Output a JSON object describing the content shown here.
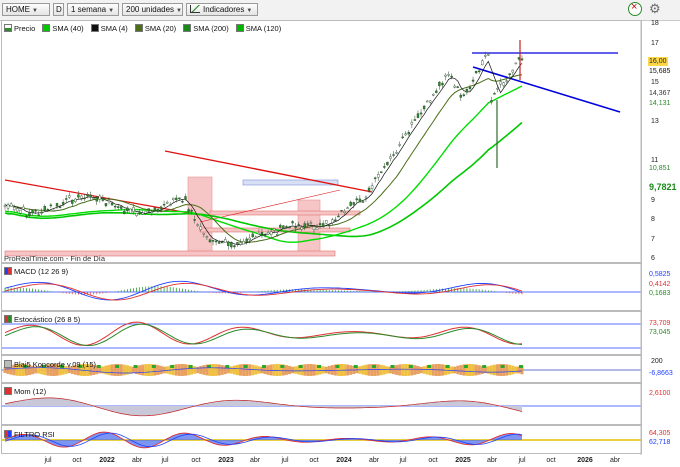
{
  "toolbar": {
    "symbol": "HOME",
    "type_btn": "D",
    "period": "1 semana",
    "units": "200 unidades",
    "indicators": "Indicadores"
  },
  "legend": {
    "price": "Precio",
    "sma40": "SMA (40)",
    "sma4": "SMA (4)",
    "sma20": "SMA (20)",
    "sma200": "SMA (200)",
    "sma120": "SMA (120)",
    "source": "ProRealTime.com - Fin de Día"
  },
  "price_axis": {
    "ticks": [
      "18",
      "17",
      "15",
      "14",
      "13",
      "11",
      "10",
      "9",
      "8",
      "7",
      "6"
    ],
    "labels": {
      "last": "16,00",
      "high": "15,685",
      "sma4": "14,367",
      "sma20": "14,131",
      "sma40": "10,851",
      "sma120": "9,7821"
    }
  },
  "panels": {
    "macd": {
      "label": "MACD (12 26 9)",
      "values": [
        "0,5825",
        "0,4142",
        "0,1683"
      ]
    },
    "stoch": {
      "label": "Estocástico (26 8 5)",
      "values": [
        "73,709",
        "73,045"
      ]
    },
    "konc": {
      "label": "Blai5 Koncorde v.09 (15)",
      "value": "-6,8663",
      "tick": "200"
    },
    "mom": {
      "label": "Mom (12)",
      "value": "2,6100"
    },
    "rsi": {
      "label": "FILTRO RSI",
      "values": [
        "64,305",
        "62,718"
      ]
    }
  },
  "x_axis": [
    "jul",
    "oct",
    "2022",
    "abr",
    "jul",
    "oct",
    "2023",
    "abr",
    "jul",
    "oct",
    "2024",
    "abr",
    "jul",
    "oct",
    "2025",
    "abr",
    "jul",
    "oct",
    "2026",
    "abr"
  ],
  "colors": {
    "candle_up": "#2e8b2e",
    "sma40": "#00c800",
    "sma4": "#111111",
    "sma20": "#4a6e1a",
    "sma200": "#1a8a1a",
    "sma120": "#00b400",
    "trend_red": "#e01010",
    "trend_blue": "#0000dd",
    "macd_blue": "#2040ff",
    "macd_red": "#e03030"
  }
}
